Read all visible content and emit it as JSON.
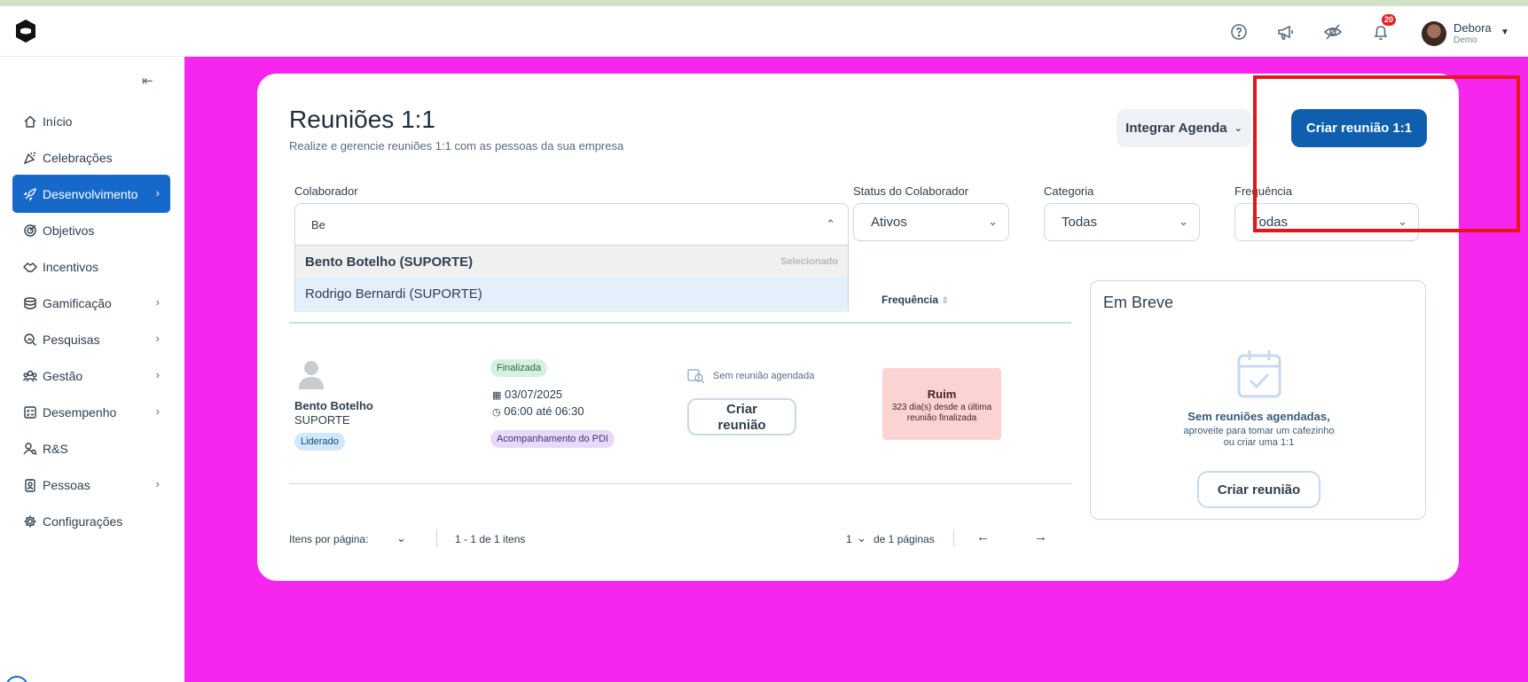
{
  "topbar": {
    "badge_count": "20",
    "user_name": "Debora",
    "user_sub": "Demo",
    "icons": [
      "help-circle-icon",
      "megaphone-icon",
      "eye-off-icon",
      "bell-icon"
    ]
  },
  "sidebar": {
    "items": [
      {
        "label": "Início",
        "icon": "home-icon"
      },
      {
        "label": "Celebrações",
        "icon": "party-icon"
      },
      {
        "label": "Desenvolvimento",
        "icon": "rocket-icon"
      },
      {
        "label": "Objetivos",
        "icon": "target-icon"
      },
      {
        "label": "Incentivos",
        "icon": "handshake-icon"
      },
      {
        "label": "Gamificação",
        "icon": "database-icon"
      },
      {
        "label": "Pesquisas",
        "icon": "search-analytics-icon"
      },
      {
        "label": "Gestão",
        "icon": "users-icon"
      },
      {
        "label": "Desempenho",
        "icon": "checklist-icon"
      },
      {
        "label": "R&S",
        "icon": "user-search-icon"
      },
      {
        "label": "Pessoas",
        "icon": "id-badge-icon"
      },
      {
        "label": "Configurações",
        "icon": "gear-icon"
      }
    ]
  },
  "page": {
    "title": "Reuniões 1:1",
    "subtitle": "Realize e gerencie reuniões 1:1 com as pessoas da sua empresa",
    "integrar_label": "Integrar Agenda",
    "criar_label": "Criar reunião 1:1"
  },
  "filters": {
    "colaborador_label": "Colaborador",
    "colaborador_value": "Be",
    "status_label": "Status do Colaborador",
    "status_value": "Ativos",
    "categoria_label": "Categoria",
    "categoria_value": "Todas",
    "frequencia_label": "Frequência",
    "frequencia_value": "Todas",
    "dropdown_options": [
      {
        "label": "Bento Botelho (SUPORTE)",
        "tag": "Selecionado"
      },
      {
        "label": "Rodrigo Bernardi (SUPORTE)",
        "tag": ""
      }
    ]
  },
  "table": {
    "header_frequencia": "Frequência",
    "row": {
      "name": "Bento Botelho",
      "dept": "SUPORTE",
      "role_tag": "Liderado",
      "status_tag": "Finalizada",
      "date": "03/07/2025",
      "time": "06:00 até 06:30",
      "category_tag": "Acompanhamento do PDI",
      "sem_reuniao": "Sem reunião agendada",
      "criar_line1": "Criar",
      "criar_line2": "reunião",
      "freq_title": "Ruim",
      "freq_desc": "323 dia(s) desde a última reunião finalizada"
    }
  },
  "em_breve": {
    "title": "Em Breve",
    "message": "Sem reuniões agendadas,",
    "sub_line1": "aproveite para tomar um cafezinho",
    "sub_line2": "ou criar uma 1:1",
    "button": "Criar reunião"
  },
  "pagination": {
    "itens_label": "Itens por página:",
    "range": "1 - 1 de 1 itens",
    "page": "1",
    "pages_label": "de 1 páginas"
  },
  "colors": {
    "accent": "#1769c9",
    "primary_button": "#0f5fae",
    "background": "#f626ef",
    "highlight_box": "#e8141c"
  }
}
